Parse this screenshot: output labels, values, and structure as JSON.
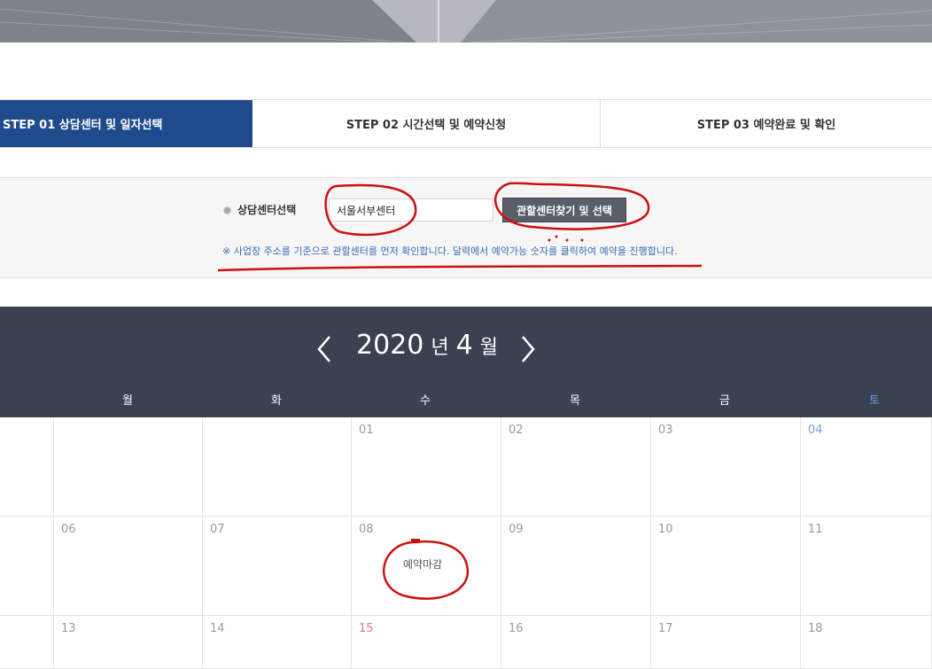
{
  "steps": {
    "step1": "STEP 01 상담센터 및 일자선택",
    "step2": "STEP 02 시간선택 및 예약신청",
    "step3": "STEP 03 예약완료 및 확인"
  },
  "search": {
    "label": "상담센터선택",
    "value": "서울서부센터",
    "button_label": "관할센터찾기 및 선택",
    "notice": "※  사업장 주소를 기준으로 관할센터를 먼저 확인합니다. 달력에서 예약가능 숫자를 클릭하여 예약을 진행합니다."
  },
  "calendar": {
    "year": "2020",
    "year_unit": "년",
    "month": "4",
    "month_unit": "월",
    "weekdays": [
      "월",
      "화",
      "수",
      "목",
      "금",
      "토"
    ],
    "week1": [
      "",
      "",
      "01",
      "02",
      "03",
      "04"
    ],
    "week2": [
      "06",
      "07",
      "08",
      "09",
      "10",
      "11"
    ],
    "week3": [
      "13",
      "14",
      "15",
      "16",
      "17",
      "18"
    ],
    "closed_label": "예약마감"
  },
  "colors": {
    "step_active": "#1f4a8c",
    "calendar_header": "#3a4150",
    "saturday": "#7aa3d6",
    "holiday": "#e07b7b",
    "annotation": "#cc1111"
  }
}
